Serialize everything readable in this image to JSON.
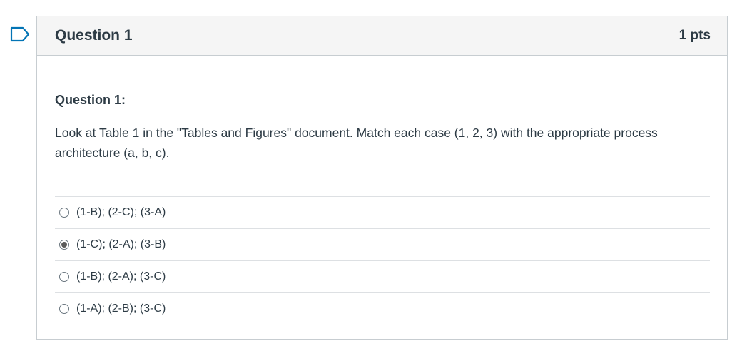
{
  "question": {
    "title": "Question 1",
    "points": "1 pts",
    "subtitle": "Question 1:",
    "text": "Look at Table 1 in the \"Tables and Figures\" document. Match each case (1, 2, 3) with the appropriate process architecture (a, b, c).",
    "flag_icon": "bookmark-flag-icon",
    "answers": [
      {
        "label": "(1-B); (2-C); (3-A)",
        "selected": false
      },
      {
        "label": "(1-C); (2-A); (3-B)",
        "selected": true
      },
      {
        "label": "(1-B); (2-A); (3-C)",
        "selected": false
      },
      {
        "label": "(1-A); (2-B); (3-C)",
        "selected": false
      }
    ]
  },
  "colors": {
    "flag": "#0374b5",
    "text": "#2d3b45",
    "header_bg": "#f5f5f5",
    "border": "#c7cdd1"
  }
}
